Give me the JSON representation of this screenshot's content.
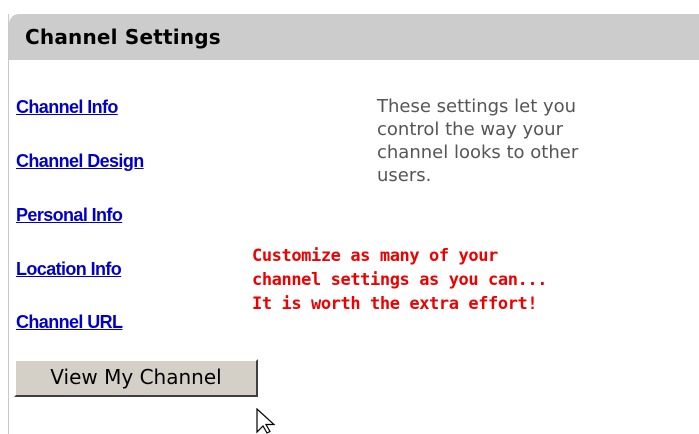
{
  "header": {
    "title": "Channel Settings"
  },
  "nav": {
    "links": [
      {
        "label": "Channel Info"
      },
      {
        "label": "Channel Design"
      },
      {
        "label": "Personal Info"
      },
      {
        "label": "Location Info"
      },
      {
        "label": "Channel URL"
      }
    ]
  },
  "description": {
    "lines": [
      "These settings let you",
      "control the way your",
      "channel looks to other",
      "users."
    ]
  },
  "callout": {
    "lines": [
      "Customize as many of your",
      "channel settings as you can...",
      "It is worth the extra effort!"
    ],
    "color": "#ee0000"
  },
  "button": {
    "label": "View My Channel"
  },
  "colors": {
    "link": "#0000cc",
    "header_bg": "#cccccc",
    "description": "#555555"
  },
  "cursor": {
    "icon": "arrow-pointer-icon"
  }
}
